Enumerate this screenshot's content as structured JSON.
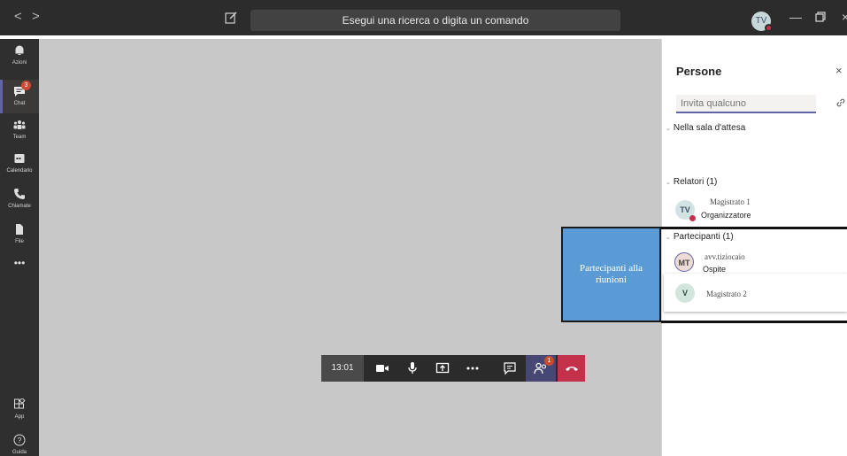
{
  "titlebar": {
    "back": "<",
    "forward": ">",
    "search_text": "Esegui una ricerca o digita un comando",
    "avatar_initials": "TV"
  },
  "rail": {
    "items": [
      {
        "label": "Azioni",
        "icon": "bell-icon"
      },
      {
        "label": "Chat",
        "icon": "chat-icon",
        "badge": "3"
      },
      {
        "label": "Team",
        "icon": "team-icon"
      },
      {
        "label": "Calendario",
        "icon": "calendar-icon"
      },
      {
        "label": "Chiamate",
        "icon": "phone-icon"
      },
      {
        "label": "File",
        "icon": "file-icon"
      },
      {
        "label": "•••",
        "icon": "more-icon"
      }
    ],
    "bottom": [
      {
        "label": "App",
        "icon": "apps-icon"
      },
      {
        "label": "Guida",
        "icon": "help-icon"
      }
    ]
  },
  "callbar": {
    "time": "13:01",
    "people_badge": "1"
  },
  "panel": {
    "title": "Persone",
    "close": "×",
    "invite_placeholder": "Invita qualcuno",
    "lobby_section": "Nella sala d'attesa",
    "presenters_section": "Relatori (1)",
    "participants_section": "Partecipanti (1)",
    "presenters": [
      {
        "initials": "TV",
        "name": "Magistrato 1",
        "role": "Organizzatore"
      }
    ],
    "participants": [
      {
        "initials": "MT",
        "name": "avv.tiziocaio",
        "role": "Ospite"
      },
      {
        "initials": "V",
        "name": "Magistrato 2",
        "role": ""
      }
    ]
  },
  "callout": {
    "text": "Partecipanti alla riunioni"
  },
  "colors": {
    "accent": "#6264a7",
    "hangup": "#c4314b",
    "callout": "#5b9bd5",
    "stage": "#c8c8c8"
  }
}
